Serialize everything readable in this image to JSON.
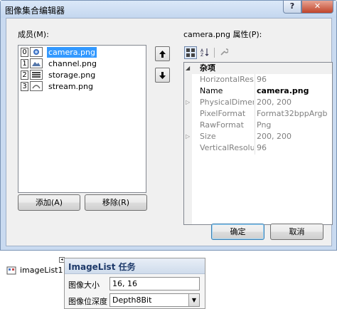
{
  "dialog": {
    "title": "图像集合编辑器",
    "help_label": "?",
    "close_label": "✕",
    "members_label": "成员(M):",
    "members": [
      {
        "index": "0",
        "name": "camera.png",
        "selected": true
      },
      {
        "index": "1",
        "name": "channel.png",
        "selected": false
      },
      {
        "index": "2",
        "name": "storage.png",
        "selected": false
      },
      {
        "index": "3",
        "name": "stream.png",
        "selected": false
      }
    ],
    "up_icon": "arrow-up-icon",
    "down_icon": "arrow-down-icon",
    "add_label": "添加(A)",
    "remove_label": "移除(R)",
    "props_label": "camera.png 属性(P):",
    "category": "杂项",
    "properties": [
      {
        "name": "HorizontalResolution",
        "value": "96",
        "expandable": false,
        "dark": false,
        "bold": false
      },
      {
        "name": "Name",
        "value": "camera.png",
        "expandable": false,
        "dark": true,
        "bold": true
      },
      {
        "name": "PhysicalDimension",
        "value": "200, 200",
        "expandable": true,
        "dark": false,
        "bold": false
      },
      {
        "name": "PixelFormat",
        "value": "Format32bppArgb",
        "expandable": false,
        "dark": false,
        "bold": false
      },
      {
        "name": "RawFormat",
        "value": "Png",
        "expandable": false,
        "dark": false,
        "bold": false
      },
      {
        "name": "Size",
        "value": "200, 200",
        "expandable": true,
        "dark": false,
        "bold": false
      },
      {
        "name": "VerticalResolution",
        "value": "96",
        "expandable": false,
        "dark": false,
        "bold": false
      }
    ],
    "ok_label": "确定",
    "cancel_label": "取消"
  },
  "designer": {
    "component_name": "imageList1",
    "task_title": "ImageList 任务",
    "image_size_label": "图像大小",
    "image_size_value": "16, 16",
    "bit_depth_label": "图像位深度",
    "bit_depth_value": "Depth8Bit"
  },
  "colors": {
    "selection": "#3399ff",
    "dialog_frame": "#c9daf0"
  }
}
